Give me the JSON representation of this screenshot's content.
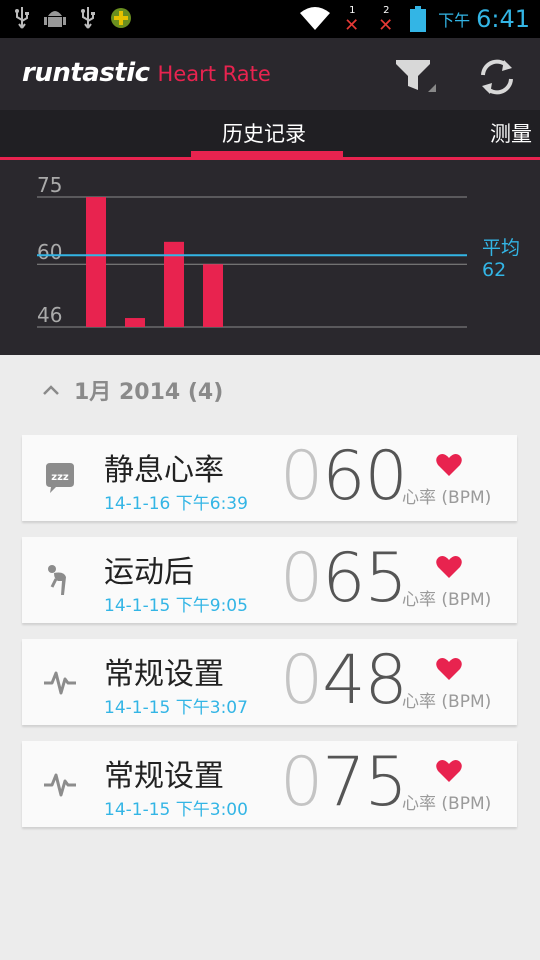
{
  "status_bar": {
    "sim1": "1",
    "sim2": "2",
    "sim_blocked": "✕",
    "ampm": "下午",
    "time": "6:41"
  },
  "header": {
    "brand": "runtastic",
    "product": "Heart Rate",
    "filter_icon": "filter-icon",
    "refresh_icon": "refresh-icon"
  },
  "tabs": [
    {
      "label": "历史记录",
      "selected": true
    },
    {
      "label": "测量",
      "selected": false
    }
  ],
  "colors": {
    "accent": "#e8234f",
    "blue": "#33b5e5",
    "header_bg": "#2a282d"
  },
  "chart_data": {
    "type": "bar",
    "categories": [
      "14-1-15 下午3:00",
      "14-1-15 下午3:07",
      "14-1-15 下午9:05",
      "14-1-16 下午6:39"
    ],
    "values": [
      75,
      48,
      65,
      60
    ],
    "y_ticks": [
      "75",
      "60",
      "46"
    ],
    "y_tick_values": [
      75,
      60,
      46
    ],
    "ylim": [
      46,
      75
    ],
    "average_label": "平均",
    "average_value": "62",
    "average": 62,
    "grid": true
  },
  "list": {
    "group_header": "1月 2014 (4)",
    "unit": "心率 (BPM)",
    "items": [
      {
        "title": "静息心率",
        "date": "14-1-16 下午6:39",
        "lead": "0",
        "value": "60",
        "icon": "zzz-icon"
      },
      {
        "title": "运动后",
        "date": "14-1-15 下午9:05",
        "lead": "0",
        "value": "65",
        "icon": "exhausted-runner-icon"
      },
      {
        "title": "常规设置",
        "date": "14-1-15 下午3:07",
        "lead": "0",
        "value": "48",
        "icon": "pulse-icon"
      },
      {
        "title": "常规设置",
        "date": "14-1-15 下午3:00",
        "lead": "0",
        "value": "75",
        "icon": "pulse-icon"
      }
    ]
  }
}
